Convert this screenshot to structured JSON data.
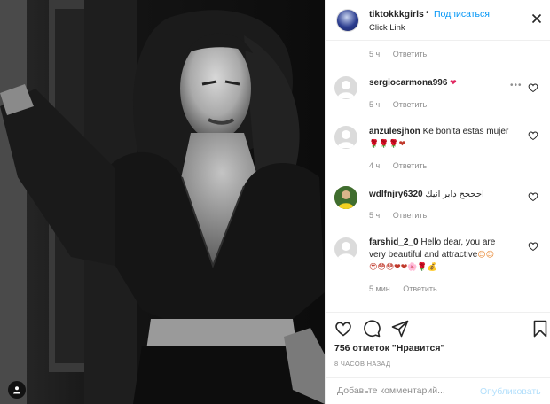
{
  "post": {
    "username": "tiktokkkgirls",
    "separator": "•",
    "follow_label": "Подписаться",
    "subtitle": "Click Link"
  },
  "first_meta": {
    "time": "5 ч.",
    "reply": "Ответить"
  },
  "comments": [
    {
      "username": "sergiocarmona996",
      "text": "",
      "emoji": "❤",
      "time": "5 ч.",
      "reply": "Ответить"
    },
    {
      "username": "anzulesjhon",
      "text": "Ke bonita estas mujer",
      "emoji": "🌹🌹🌹❤",
      "time": "4 ч.",
      "reply": "Ответить"
    },
    {
      "username": "wdlfnjry6320",
      "text": "احححح دابر انيك",
      "emoji": "",
      "time": "5 ч.",
      "reply": "Ответить"
    },
    {
      "username": "farshid_2_0",
      "text": "Hello dear, you are very beautiful and attractive",
      "emoji": "😍😍",
      "emoji_line2": "😍😳😳❤❤🌸🌹💰",
      "time": "5 мин.",
      "reply": "Ответить"
    }
  ],
  "likes": "756 отметок \"Нравится\"",
  "timestamp": "8 ЧАСОВ НАЗАД",
  "composer": {
    "placeholder": "Добавьте комментарий...",
    "post_label": "Опубликовать"
  },
  "icons": [
    "heart-icon",
    "comment-icon",
    "share-icon",
    "bookmark-icon",
    "close-icon",
    "more-icon",
    "user-tag-icon"
  ]
}
